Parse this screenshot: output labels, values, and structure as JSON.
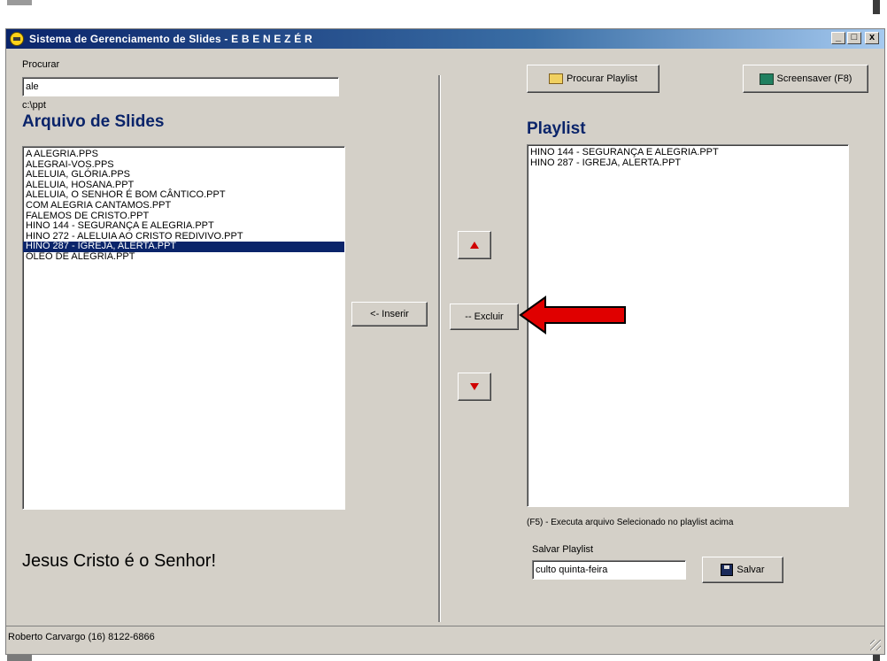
{
  "window": {
    "title": "Sistema de Gerenciamento de Slides - E B E N E Z É R",
    "controls": {
      "minimize": "_",
      "maximize": "□",
      "close": "x"
    }
  },
  "search": {
    "label": "Procurar",
    "value": "ale"
  },
  "path": "c:\\ppt",
  "files": {
    "heading": "Arquivo de Slides",
    "items": [
      "A ALEGRIA.PPS",
      "ALEGRAI-VOS.PPS",
      "ALELUIA, GLÓRIA.PPS",
      "ALELUIA, HOSANA.PPT",
      "ALELUIA, O SENHOR É BOM CÂNTICO.PPT",
      "COM ALEGRIA CANTAMOS.PPT",
      "FALEMOS DE CRISTO.PPT",
      "HINO 144 - SEGURANÇA E ALEGRIA.PPT",
      "HINO 272 - ALELUIA AO CRISTO REDIVIVO.PPT",
      "HINO 287 - IGREJA, ALERTA.PPT",
      "OLEO DE ALEGRIA.PPT"
    ],
    "selected_index": 9
  },
  "buttons": {
    "insert": "<- Inserir",
    "remove": "-- Excluir",
    "open_playlist": "Procurar Playlist",
    "screensaver": "Screensaver (F8)",
    "save": "Salvar"
  },
  "playlist": {
    "heading": "Playlist",
    "items": [
      "HINO 144 - SEGURANÇA E ALEGRIA.PPT",
      "HINO 287 - IGREJA, ALERTA.PPT"
    ],
    "hint": "(F5) - Executa arquivo Selecionado no playlist acima"
  },
  "save_playlist": {
    "label": "Salvar Playlist",
    "value": "culto quinta-feira"
  },
  "motto": "Jesus Cristo é o Senhor!",
  "status": "Roberto Carvargo (16) 8122-6866",
  "colors": {
    "titlebar": "#0a246a",
    "selection": "#0a246a",
    "heading": "#0a246a",
    "annotation_arrow": "#e00000"
  }
}
